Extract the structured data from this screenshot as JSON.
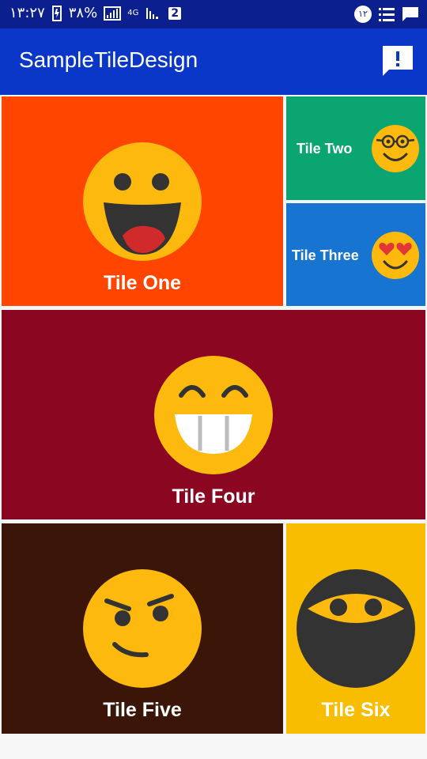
{
  "status_bar": {
    "time": "۱۳:۲۷",
    "battery_percent": "۳۸%",
    "network_type": "4G",
    "sim_badge": "2",
    "notification_count": "۱۲",
    "icons": [
      "battery-icon",
      "signal-icon",
      "signal-2-icon",
      "notification-badge-icon",
      "list-icon",
      "message-icon"
    ]
  },
  "app_bar": {
    "title": "SampleTileDesign",
    "action_icon": "feedback-icon"
  },
  "tiles": [
    {
      "label": "Tile One",
      "color": "#ff4500",
      "icon": "laughing-face-icon"
    },
    {
      "label": "Tile Two",
      "color": "#0ba572",
      "icon": "nerd-face-icon"
    },
    {
      "label": "Tile Three",
      "color": "#1775d1",
      "icon": "heart-eyes-face-icon"
    },
    {
      "label": "Tile Four",
      "color": "#8b0620",
      "icon": "grinning-face-icon"
    },
    {
      "label": "Tile Five",
      "color": "#3b1608",
      "icon": "smirking-face-icon"
    },
    {
      "label": "Tile Six",
      "color": "#f8bd00",
      "icon": "ninja-face-icon"
    }
  ]
}
